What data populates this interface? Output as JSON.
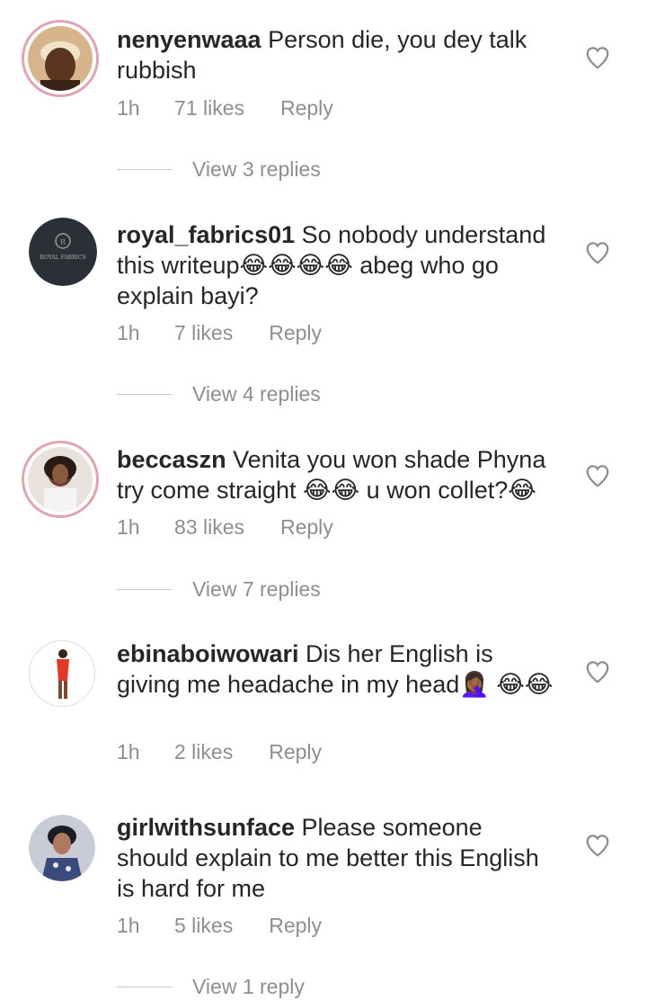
{
  "comments": [
    {
      "username": "nenyenwaaa",
      "text": " Person die, you dey talk rubbish",
      "time": "1h",
      "likes": "71 likes",
      "reply": "Reply",
      "view_replies": "View 3 replies"
    },
    {
      "username": "royal_fabrics01",
      "text": " So nobody understand this writeup😂😂😂😂 abeg who go explain bayi?",
      "time": "1h",
      "likes": "7 likes",
      "reply": "Reply",
      "view_replies": "View 4 replies",
      "avatar_logo_text": "ROYAL FABRICS"
    },
    {
      "username": "beccaszn",
      "text": " Venita you won shade Phyna try come straight 😂😂 u won collet?😂",
      "time": "1h",
      "likes": "83 likes",
      "reply": "Reply",
      "view_replies": "View 7 replies"
    },
    {
      "username": "ebinaboiwowari",
      "text": " Dis her English is giving me headache in my head🤦🏾‍♀️ 😂😂",
      "time": "1h",
      "likes": "2 likes",
      "reply": "Reply",
      "view_replies": ""
    },
    {
      "username": "girlwithsunface",
      "text": " Please someone should explain to me better this English is hard for me",
      "time": "1h",
      "likes": "5 likes",
      "reply": "Reply",
      "view_replies": "View 1 reply"
    }
  ],
  "colors": {
    "text": "#262626",
    "meta": "#8e8e8e",
    "story_ring": "#e0a4b3"
  },
  "icons": {
    "like": "heart-outline-icon"
  }
}
